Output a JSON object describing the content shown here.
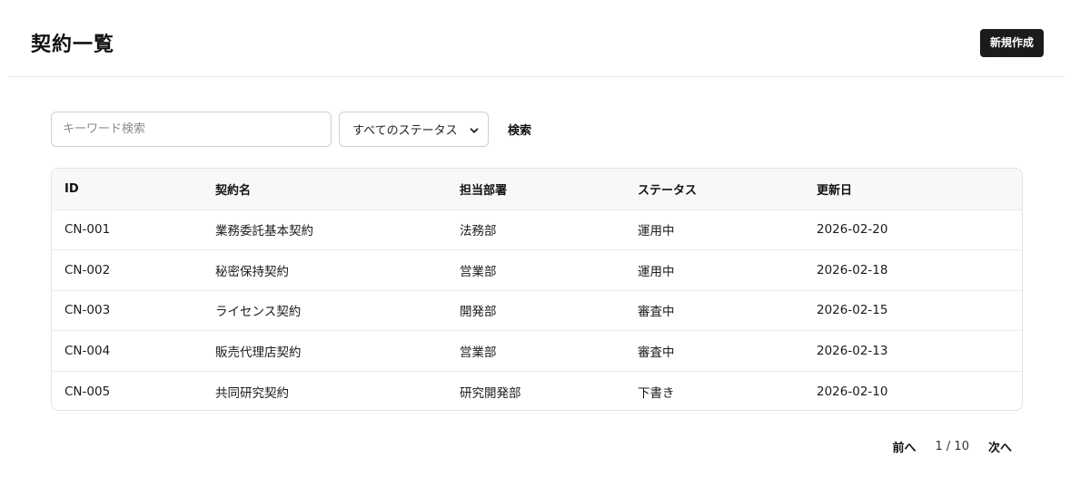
{
  "header": {
    "title": "契約一覧",
    "new_button_label": "新規作成"
  },
  "filters": {
    "search_placeholder": "キーワード検索",
    "search_value": "",
    "status_selected": "すべてのステータス",
    "search_button_label": "検索"
  },
  "table": {
    "columns": [
      "ID",
      "契約名",
      "担当部署",
      "ステータス",
      "更新日"
    ],
    "rows": [
      {
        "id": "CN-001",
        "name": "業務委託基本契約",
        "dept": "法務部",
        "status": "運用中",
        "updated": "2026-02-20"
      },
      {
        "id": "CN-002",
        "name": "秘密保持契約",
        "dept": "営業部",
        "status": "運用中",
        "updated": "2026-02-18"
      },
      {
        "id": "CN-003",
        "name": "ライセンス契約",
        "dept": "開発部",
        "status": "審査中",
        "updated": "2026-02-15"
      },
      {
        "id": "CN-004",
        "name": "販売代理店契約",
        "dept": "営業部",
        "status": "審査中",
        "updated": "2026-02-13"
      },
      {
        "id": "CN-005",
        "name": "共同研究契約",
        "dept": "研究開発部",
        "status": "下書き",
        "updated": "2026-02-10"
      }
    ]
  },
  "pagination": {
    "prev_label": "前へ",
    "page_indicator": "1 / 10",
    "next_label": "次へ"
  },
  "icons": {
    "select_chevron": "chevron-down-icon"
  }
}
